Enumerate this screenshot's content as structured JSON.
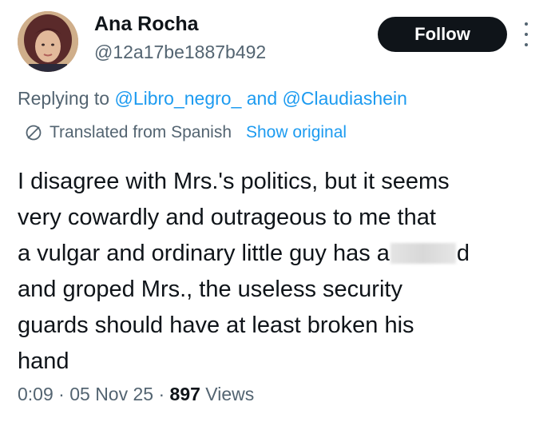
{
  "author": {
    "name": "Ana Rocha",
    "handle": "@12a17be1887b492"
  },
  "actions": {
    "follow_label": "Follow",
    "more_icon": "more-vertical-icon"
  },
  "reply": {
    "prefix": "Replying to",
    "mention_1": "@Libro_negro_",
    "joiner": "and",
    "mention_2": "@Claudiashein"
  },
  "translation": {
    "icon": "globe-icon",
    "text": "Translated from Spanish",
    "show_original": "Show original"
  },
  "tweet": {
    "lines": [
      "I disagree with Mrs.'s politics, but it seems",
      "very cowardly and outrageous to me that",
      "a vulgar and ordinary little guy has a",
      "and groped Mrs., the useless security",
      "guards should have at least broken his",
      "hand"
    ],
    "line_3_after_redaction": "d"
  },
  "meta": {
    "time": "0:09",
    "date": "05 Nov 25",
    "views_count": "897",
    "views_label": "Views",
    "separator": "·"
  },
  "colors": {
    "text": "#0f1419",
    "secondary": "#536471",
    "link": "#1d9bf0",
    "button_bg": "#0f1419"
  }
}
